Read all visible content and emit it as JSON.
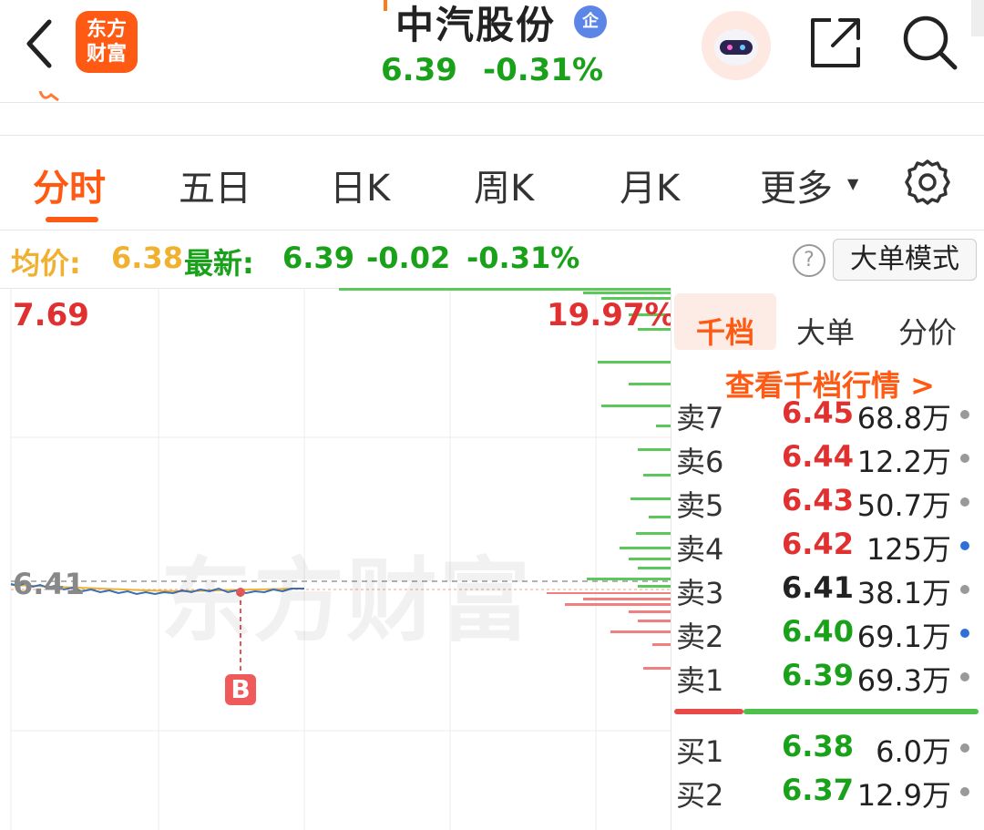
{
  "header": {
    "app_logo_line1": "东方",
    "app_logo_line2": "财富",
    "stock_name": "中汽股份",
    "badge": "企",
    "price": "6.39",
    "change_pct": "-0.31%"
  },
  "tabs": [
    {
      "label": "分时",
      "active": true
    },
    {
      "label": "五日"
    },
    {
      "label": "日K"
    },
    {
      "label": "周K"
    },
    {
      "label": "月K"
    },
    {
      "label": "更多"
    }
  ],
  "info_bar": {
    "avg_label": "均价:",
    "avg_value": "6.38",
    "latest_label": "最新:",
    "latest_value": "6.39",
    "change": "-0.02",
    "change_pct": "-0.31%",
    "help": "?",
    "big_order_mode": "大单模式"
  },
  "chart": {
    "top_price": "7.69",
    "top_pct": "19.97%",
    "mid_price": "6.41",
    "watermark": "东方财富",
    "marker": "B"
  },
  "order_panel": {
    "tabs": [
      {
        "label": "千档",
        "active": true
      },
      {
        "label": "大单"
      },
      {
        "label": "分价"
      }
    ],
    "link": "查看千档行情 >",
    "asks": [
      {
        "label": "卖7",
        "price": "6.45",
        "vol": "68.8万",
        "price_color": "#e03030",
        "dot": "#999999"
      },
      {
        "label": "卖6",
        "price": "6.44",
        "vol": "12.2万",
        "price_color": "#e03030",
        "dot": "#999999"
      },
      {
        "label": "卖5",
        "price": "6.43",
        "vol": "50.7万",
        "price_color": "#e03030",
        "dot": "#999999"
      },
      {
        "label": "卖4",
        "price": "6.42",
        "vol": "125万",
        "price_color": "#e03030",
        "dot": "#2f6fd6"
      },
      {
        "label": "卖3",
        "price": "6.41",
        "vol": "38.1万",
        "price_color": "#222222",
        "dot": "#999999"
      },
      {
        "label": "卖2",
        "price": "6.40",
        "vol": "69.1万",
        "price_color": "#1aa11a",
        "dot": "#2f6fd6"
      },
      {
        "label": "卖1",
        "price": "6.39",
        "vol": "69.3万",
        "price_color": "#1aa11a",
        "dot": "#999999"
      }
    ],
    "bids": [
      {
        "label": "买1",
        "price": "6.38",
        "vol": "6.0万",
        "price_color": "#1aa11a",
        "dot": "#999999"
      },
      {
        "label": "买2",
        "price": "6.37",
        "vol": "12.9万",
        "price_color": "#1aa11a",
        "dot": "#999999"
      }
    ]
  },
  "colors": {
    "accent": "#ff5a14",
    "up": "#e03030",
    "down": "#1aa11a",
    "avg": "#f0b030"
  }
}
